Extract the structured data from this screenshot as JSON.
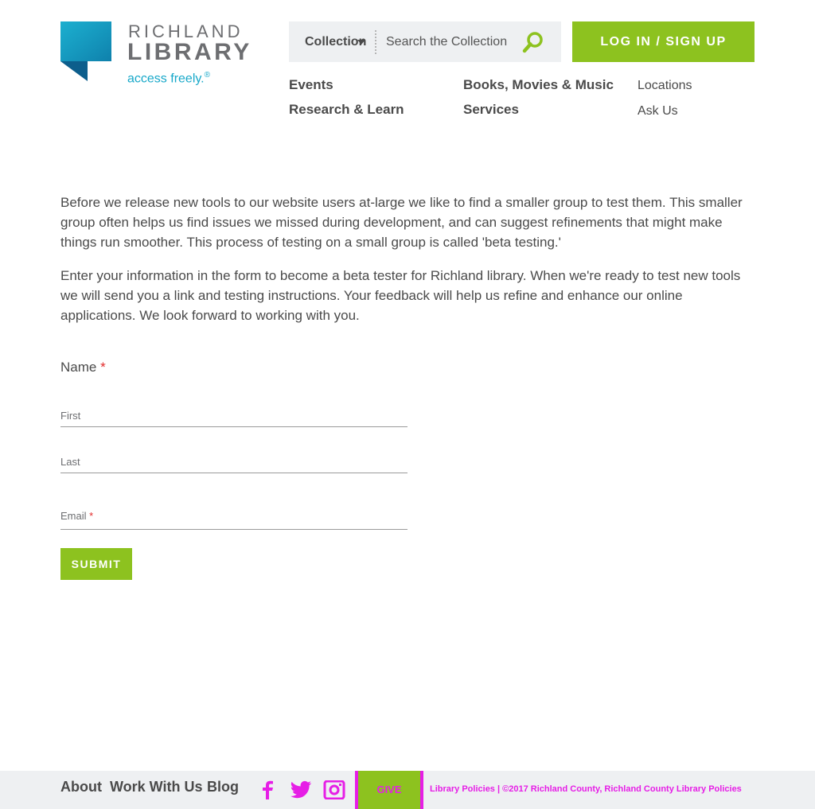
{
  "header": {
    "logo": {
      "top_text": "RICHLAND",
      "bottom_text": "LIBRARY",
      "tagline": "access freely.",
      "tagline_mark": "®",
      "colors": {
        "mark": "#17a8c9",
        "text": "#6d6e71"
      }
    },
    "search": {
      "scope_label": "Collection",
      "placeholder": "Search the Collection",
      "button_icon": "search-icon"
    },
    "login_label": "LOG IN / SIGN UP",
    "nav": {
      "primary": [
        "Events",
        "Research & Learn",
        "Books, Movies & Music",
        "Services"
      ],
      "secondary": [
        "Locations",
        "Ask Us"
      ]
    }
  },
  "main": {
    "paragraphs": [
      "Before we release new tools to our website users at-large we like to find a smaller group to test them. This smaller group often helps us find issues we missed during development, and can suggest refinements that might make things run smoother. This process of testing on a small group is called 'beta testing.'",
      "Enter your information in the form to become a beta tester for Richland library. When we're ready to test new tools we will send you a link and testing instructions. Your feedback will help us refine and enhance our online applications. We look forward to working with you."
    ],
    "form": {
      "name_label": "Name",
      "required_mark": "*",
      "first_placeholder": "First",
      "last_placeholder": "Last",
      "email_label": "Email",
      "submit_label": "SUBMIT"
    }
  },
  "footer": {
    "links": [
      "About",
      "Work With Us",
      "Blog"
    ],
    "social_icons": [
      "facebook-icon",
      "twitter-icon",
      "instagram-icon"
    ],
    "give_label": "GIVE",
    "legal_text": "Library Policies | ©2017 Richland County, Richland County Library Policies"
  },
  "colors": {
    "accent_green": "#8dc21f",
    "brand_teal": "#17a8c9",
    "required_red": "#e22b2b",
    "footer_bg": "#eef0f2",
    "debug_magenta": "#e61ee6"
  }
}
